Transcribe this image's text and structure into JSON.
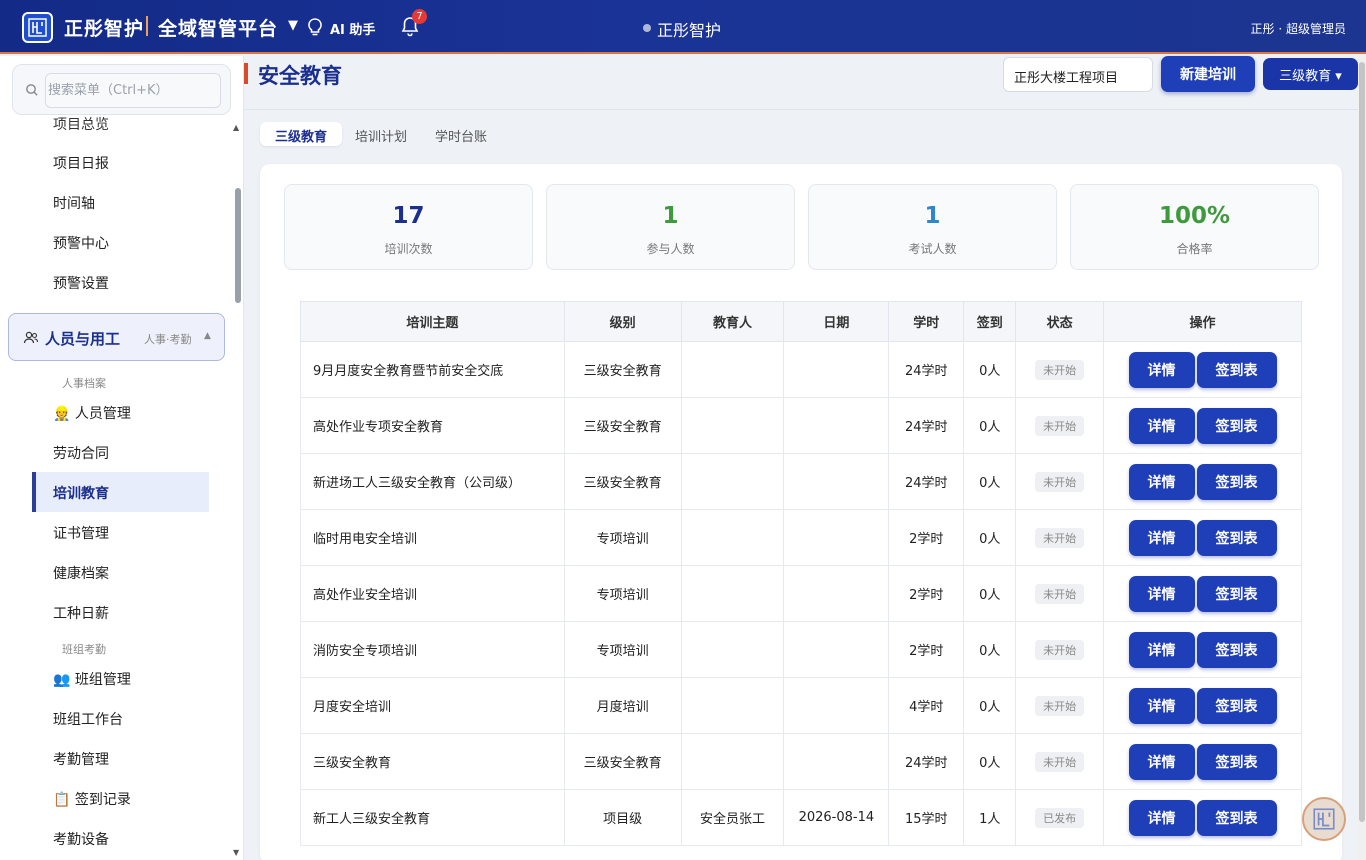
{
  "header": {
    "brand_name": "正彤智护",
    "platform_name": "全域智管平台",
    "ai_label": "AI 助手",
    "notification_count": "7",
    "center_title": "正彤智护",
    "user": "正彤 · 超级管理员"
  },
  "sidebar": {
    "search_placeholder": "搜索菜单（Ctrl+K）",
    "partial_item": "项目总览",
    "items_top": [
      "项目日报",
      "时间轴",
      "预警中心",
      "预警设置"
    ],
    "group": {
      "label": "人员与用工",
      "sub": "人事·考勤"
    },
    "section_hr": "人事档案",
    "hr_items": [
      "👷 人员管理",
      "劳动合同",
      "培训教育",
      "证书管理",
      "健康档案",
      "工种日薪"
    ],
    "section_team": "班组考勤",
    "team_items": [
      "👥 班组管理",
      "班组工作台",
      "考勤管理",
      "📋 签到记录",
      "考勤设备"
    ]
  },
  "main": {
    "title": "安全教育",
    "project": "正彤大楼工程项目",
    "new_button": "新建培训",
    "level_button": "三级教育 ▾",
    "tabs": [
      "三级教育",
      "培训计划",
      "学时台账"
    ],
    "stats": [
      {
        "value": "17",
        "label": "培训次数",
        "color": "#1b2f8e"
      },
      {
        "value": "1",
        "label": "参与人数",
        "color": "#3d9a3d"
      },
      {
        "value": "1",
        "label": "考试人数",
        "color": "#2f86c8"
      },
      {
        "value": "100%",
        "label": "合格率",
        "color": "#3d9a3d"
      }
    ],
    "table": {
      "headers": [
        "培训主题",
        "级别",
        "教育人",
        "日期",
        "学时",
        "签到",
        "状态",
        "操作"
      ],
      "detail_label": "详情",
      "sign_label": "签到表",
      "rows": [
        {
          "topic": "9月月度安全教育暨节前安全交底",
          "level": "三级安全教育",
          "teacher": "",
          "date": "",
          "hours": "24学时",
          "signin": "0人",
          "status": "未开始"
        },
        {
          "topic": "高处作业专项安全教育",
          "level": "三级安全教育",
          "teacher": "",
          "date": "",
          "hours": "24学时",
          "signin": "0人",
          "status": "未开始"
        },
        {
          "topic": "新进场工人三级安全教育（公司级）",
          "level": "三级安全教育",
          "teacher": "",
          "date": "",
          "hours": "24学时",
          "signin": "0人",
          "status": "未开始"
        },
        {
          "topic": "临时用电安全培训",
          "level": "专项培训",
          "teacher": "",
          "date": "",
          "hours": "2学时",
          "signin": "0人",
          "status": "未开始"
        },
        {
          "topic": "高处作业安全培训",
          "level": "专项培训",
          "teacher": "",
          "date": "",
          "hours": "2学时",
          "signin": "0人",
          "status": "未开始"
        },
        {
          "topic": "消防安全专项培训",
          "level": "专项培训",
          "teacher": "",
          "date": "",
          "hours": "2学时",
          "signin": "0人",
          "status": "未开始"
        },
        {
          "topic": "月度安全培训",
          "level": "月度培训",
          "teacher": "",
          "date": "",
          "hours": "4学时",
          "signin": "0人",
          "status": "未开始"
        },
        {
          "topic": "三级安全教育",
          "level": "三级安全教育",
          "teacher": "",
          "date": "",
          "hours": "24学时",
          "signin": "0人",
          "status": "未开始"
        },
        {
          "topic": "新工人三级安全教育",
          "level": "项目级",
          "teacher": "安全员张工",
          "date": "2026-08-14",
          "hours": "15学时",
          "signin": "1人",
          "status": "已发布"
        }
      ]
    }
  }
}
